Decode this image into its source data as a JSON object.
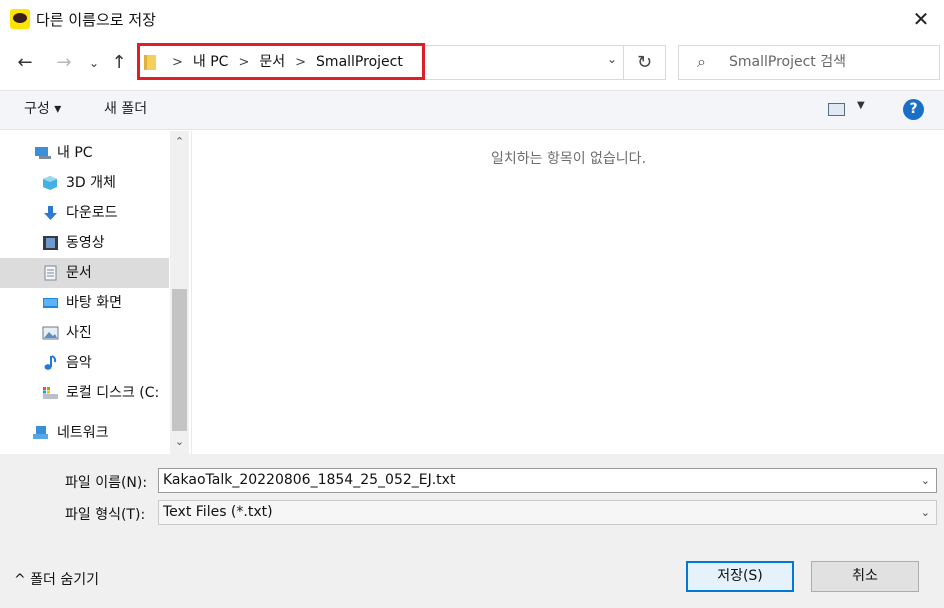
{
  "window": {
    "title": "다른 이름으로 저장",
    "close_glyph": "✕"
  },
  "address": {
    "crumbs": [
      "내 PC",
      "문서",
      "SmallProject"
    ],
    "search_placeholder": "SmallProject 검색"
  },
  "toolbar": {
    "organize_label": "구성 ▾",
    "new_folder_label": "새 폴더"
  },
  "nav": {
    "items": [
      {
        "label": "내 PC",
        "icon": "computer-icon"
      },
      {
        "label": "3D 개체",
        "icon": "cube-icon"
      },
      {
        "label": "다운로드",
        "icon": "download-icon"
      },
      {
        "label": "동영상",
        "icon": "video-icon"
      },
      {
        "label": "문서",
        "icon": "document-icon"
      },
      {
        "label": "바탕 화면",
        "icon": "desktop-icon"
      },
      {
        "label": "사진",
        "icon": "picture-icon"
      },
      {
        "label": "음악",
        "icon": "music-icon"
      },
      {
        "label": "로컬 디스크 (C:",
        "icon": "disk-icon"
      },
      {
        "label": "네트워크",
        "icon": "network-icon"
      }
    ],
    "selected_index": 4
  },
  "content": {
    "empty_message": "일치하는 항목이 없습니다."
  },
  "form": {
    "filename_label": "파일 이름(N):",
    "filename_value": "KakaoTalk_20220806_1854_25_052_EJ.txt",
    "filetype_label": "파일 형식(T):",
    "filetype_value": "Text Files (*.txt)"
  },
  "footer": {
    "hide_folders_label": "^  폴더 숨기기",
    "save_label": "저장(S)",
    "cancel_label": "취소"
  },
  "colors": {
    "highlight_red": "#e01e25",
    "accent_blue": "#0078d7"
  }
}
